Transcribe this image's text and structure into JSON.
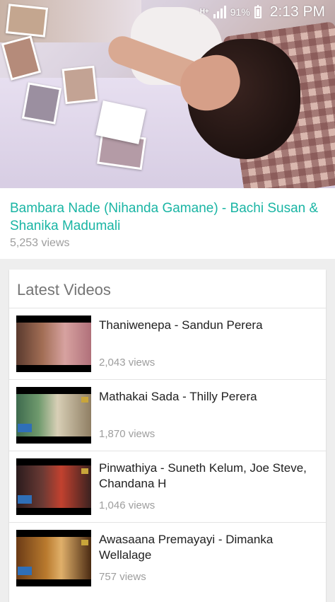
{
  "status_bar": {
    "network_type": "H+",
    "battery_percent": "91%",
    "time": "2:13 PM",
    "icons": [
      "network-type-icon",
      "signal-icon",
      "battery-icon"
    ]
  },
  "featured": {
    "title": "Bambara Nade (Nihanda Gamane) - Bachi Susan & Shanika Madumali",
    "views": "5,253 views",
    "title_color": "#1ab5a4"
  },
  "latest": {
    "heading": "Latest Videos",
    "items": [
      {
        "title": "Thaniwenepa - Sandun Perera",
        "views": "2,043 views"
      },
      {
        "title": "Mathakai Sada - Thilly Perera",
        "views": "1,870 views"
      },
      {
        "title": "Pinwathiya - Suneth Kelum, Joe Steve, Chandana H",
        "views": "1,046 views"
      },
      {
        "title": "Awasaana Premayayi - Dimanka Wellalage",
        "views": "757 views"
      }
    ]
  }
}
